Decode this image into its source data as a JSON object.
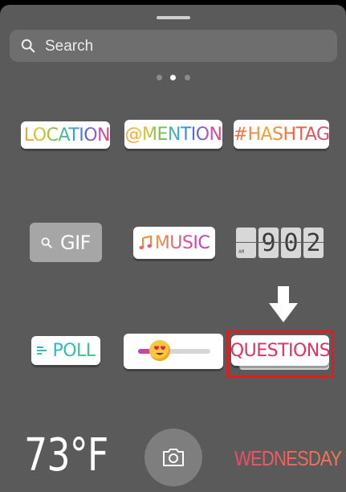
{
  "search": {
    "placeholder": "Search",
    "icon": "search-icon"
  },
  "pager": {
    "count": 3,
    "active_index": 1
  },
  "stickers": {
    "location": {
      "label": "LOCATION",
      "icon": "location-pin-icon"
    },
    "mention": {
      "label": "@MENTION"
    },
    "hashtag": {
      "label": "#HASHTAG"
    },
    "gif": {
      "label": "GIF",
      "icon": "search-icon"
    },
    "music": {
      "label": "MUSIC",
      "icon": "music-note-icon"
    },
    "clock": {
      "digits": [
        "9",
        "0",
        "2"
      ],
      "ampm": "AM"
    },
    "poll": {
      "label": "POLL",
      "icon": "poll-lines-icon"
    },
    "emoji_slider": {
      "icon": "heart-eyes-emoji-icon",
      "fill_fraction": 0.2
    },
    "questions": {
      "label": "QUESTIONS"
    }
  },
  "bottom": {
    "temperature": "73°F",
    "day": "WEDNESDAY",
    "camera_icon": "camera-icon"
  },
  "colors": {
    "sheet_bg": "#5a5a5a",
    "highlight": "#e11c1c",
    "questions_text": "#e0335e"
  }
}
